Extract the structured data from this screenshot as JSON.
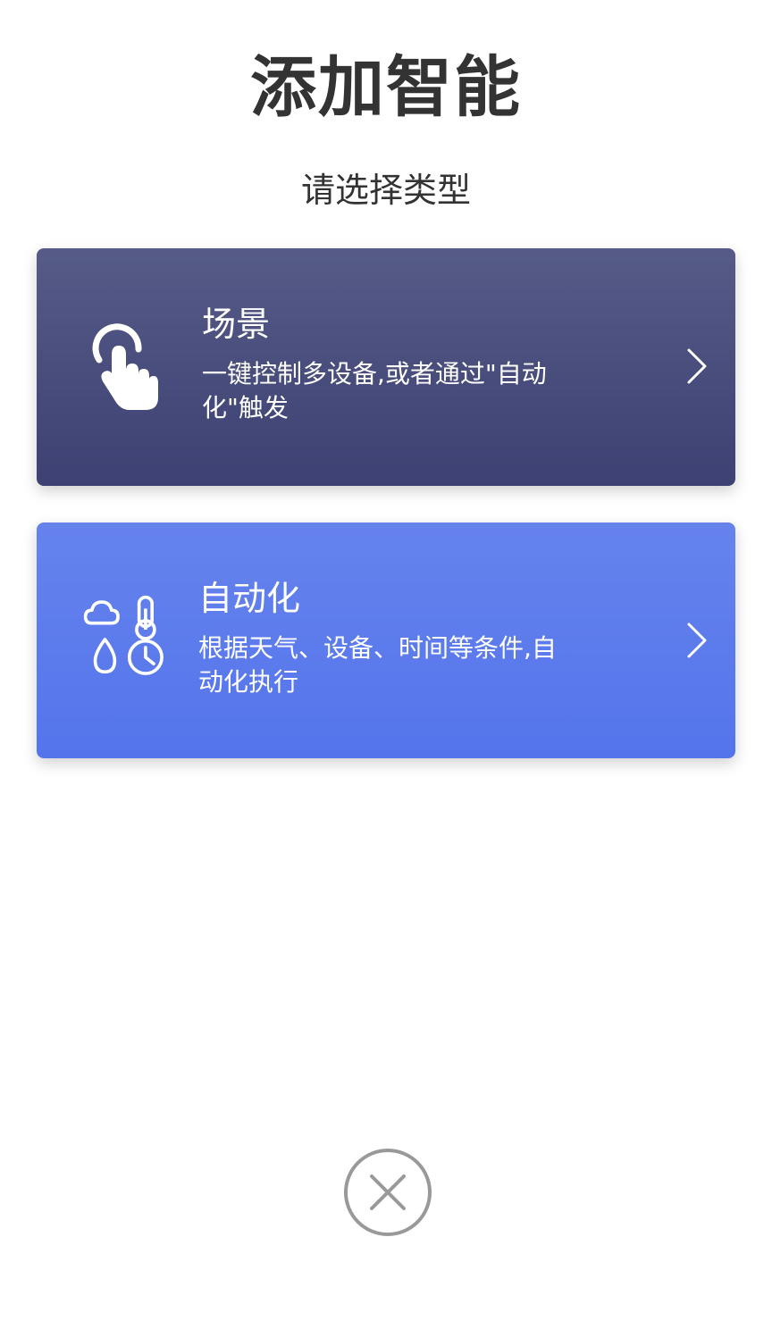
{
  "header": {
    "title": "添加智能",
    "subtitle": "请选择类型"
  },
  "cards": [
    {
      "title": "场景",
      "description": "一键控制多设备,或者通过\"自动化\"触发",
      "icon": "hand-tap-icon"
    },
    {
      "title": "自动化",
      "description": "根据天气、设备、时间等条件,自动化执行",
      "icon": "weather-time-icon"
    }
  ],
  "colors": {
    "scene_card": "#4a4e7d",
    "automation_card": "#5d7bee",
    "text_dark": "#333333",
    "close_ring": "#999999"
  },
  "close_icon": "close-circle-icon"
}
